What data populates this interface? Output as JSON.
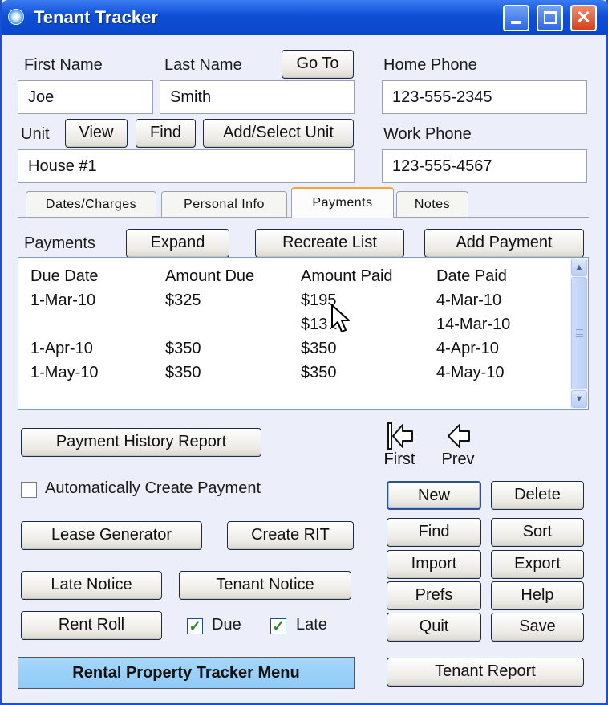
{
  "window": {
    "title": "Tenant Tracker",
    "minimize_glyph": "minimize-icon",
    "maximize_glyph": "maximize-icon",
    "close_glyph": "✕"
  },
  "tenant": {
    "first_name_label": "First Name",
    "last_name_label": "Last Name",
    "goto_label": "Go To",
    "first_name": "Joe",
    "last_name": "Smith",
    "home_phone_label": "Home Phone",
    "home_phone": "123-555-2345",
    "work_phone_label": "Work Phone",
    "work_phone": "123-555-4567",
    "unit_label": "Unit",
    "view_label": "View",
    "find_label": "Find",
    "add_select_unit_label": "Add/Select Unit",
    "unit": "House #1"
  },
  "tabs": [
    {
      "label": "Dates/Charges"
    },
    {
      "label": "Personal Info"
    },
    {
      "label": "Payments",
      "active": true
    },
    {
      "label": "Notes"
    }
  ],
  "payments": {
    "section_label": "Payments",
    "expand_label": "Expand",
    "recreate_label": "Recreate List",
    "add_label": "Add Payment",
    "columns": [
      "Due Date",
      "Amount Due",
      "Amount Paid",
      "Date Paid"
    ],
    "rows": [
      [
        "1-Mar-10",
        "$325",
        "$195",
        "4-Mar-10"
      ],
      [
        "",
        "",
        "$13…",
        "14-Mar-10"
      ],
      [
        "1-Apr-10",
        "$350",
        "$350",
        "4-Apr-10"
      ],
      [
        "1-May-10",
        "$350",
        "$350",
        "4-May-10"
      ]
    ]
  },
  "actions": {
    "payment_history": "Payment History Report",
    "auto_create_payment": "Automatically Create Payment",
    "lease_generator": "Lease Generator",
    "create_rit": "Create RIT",
    "late_notice": "Late Notice",
    "tenant_notice": "Tenant Notice",
    "rent_roll": "Rent Roll",
    "due_label": "Due",
    "late_label": "Late",
    "menu": "Rental Property Tracker Menu"
  },
  "nav": {
    "first_label": "First",
    "prev_label": "Prev",
    "new": "New",
    "delete": "Delete",
    "find": "Find",
    "sort": "Sort",
    "import": "Import",
    "export": "Export",
    "prefs": "Prefs",
    "help": "Help",
    "quit": "Quit",
    "save": "Save",
    "tenant_report": "Tenant Report"
  },
  "state": {
    "auto_create_checked": false,
    "due_checked": true,
    "late_checked": true
  },
  "colors": {
    "titlebar": "#0f4fd6",
    "window_bg": "#eceefa",
    "active_tab_accent": "#f2a53a",
    "menu_button": "#9fd3f9"
  }
}
